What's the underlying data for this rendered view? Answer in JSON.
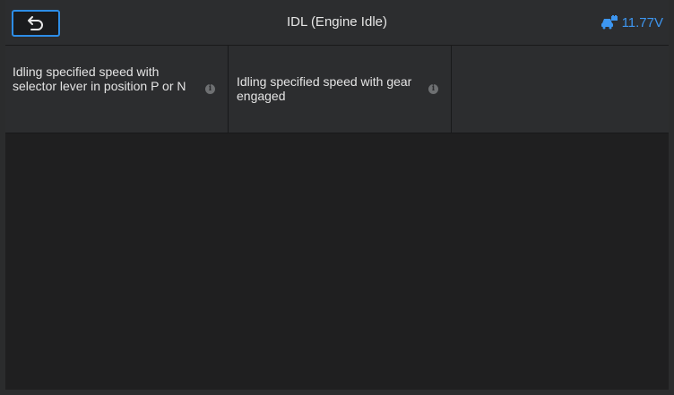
{
  "header": {
    "title": "IDL (Engine Idle)",
    "battery_voltage": "11.77V",
    "back_icon": "back-arrow-icon",
    "battery_icon": "vehicle-battery-icon",
    "accent_color": "#2d8de6"
  },
  "parameters": [
    {
      "label": "Idling specified speed with selector lever in position P or N",
      "info_icon": "info-icon"
    },
    {
      "label": "Idling specified speed with gear engaged",
      "info_icon": "info-icon"
    },
    {
      "label": "",
      "info_icon": ""
    }
  ]
}
